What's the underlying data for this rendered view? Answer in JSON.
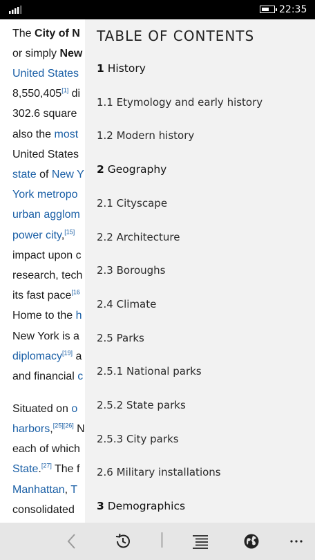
{
  "status_bar": {
    "time": "22:35",
    "battery_level": 0.6,
    "signal_bars": 4
  },
  "article": {
    "lines": [
      [
        {
          "t": "The "
        },
        {
          "t": "City of N",
          "b": true
        }
      ],
      [
        {
          "t": "or simply "
        },
        {
          "t": "New",
          "b": true
        }
      ],
      [
        {
          "t": "United States",
          "l": true
        }
      ],
      [
        {
          "t": "8,550,405"
        },
        {
          "t": "[1]",
          "s": true
        },
        {
          "t": " di"
        }
      ],
      [
        {
          "t": "302.6 square"
        }
      ],
      [
        {
          "t": "also the "
        },
        {
          "t": "most",
          "l": true
        }
      ],
      [
        {
          "t": "United States"
        }
      ],
      [
        {
          "t": "state",
          "l": true
        },
        {
          "t": " of "
        },
        {
          "t": "New Y",
          "l": true
        }
      ],
      [
        {
          "t": "York metropo",
          "l": true
        }
      ],
      [
        {
          "t": "urban agglom",
          "l": true
        }
      ],
      [
        {
          "t": "power city",
          "l": true
        },
        {
          "t": ","
        },
        {
          "t": "[15]",
          "s": true
        }
      ],
      [
        {
          "t": "impact upon c"
        }
      ],
      [
        {
          "t": "research, tech"
        }
      ],
      [
        {
          "t": "its fast pace"
        },
        {
          "t": "[16",
          "s": true
        }
      ],
      [
        {
          "t": "Home to the "
        },
        {
          "t": "h",
          "l": true
        }
      ],
      [
        {
          "t": "New York is a"
        }
      ],
      [
        {
          "t": "diplomacy",
          "l": true
        },
        {
          "t": "[19]",
          "s": true
        },
        {
          "t": " a"
        }
      ],
      [
        {
          "t": "and financial "
        },
        {
          "t": "c",
          "l": true
        }
      ],
      [
        {
          "t": "Situated on "
        },
        {
          "t": "o",
          "l": true
        }
      ],
      [
        {
          "t": "harbors",
          "l": true
        },
        {
          "t": ","
        },
        {
          "t": "[25][26]",
          "s": true
        },
        {
          "t": " N"
        }
      ],
      [
        {
          "t": "each of which"
        }
      ],
      [
        {
          "t": "State",
          "l": true
        },
        {
          "t": "."
        },
        {
          "t": "[27]",
          "s": true
        },
        {
          "t": " The f"
        }
      ],
      [
        {
          "t": "Manhattan",
          "l": true
        },
        {
          "t": ", "
        },
        {
          "t": "T",
          "l": true
        }
      ],
      [
        {
          "t": "consolidated"
        }
      ]
    ]
  },
  "toc": {
    "title": "TABLE OF CONTENTS",
    "items": [
      {
        "num": "1",
        "label": "History",
        "section": true
      },
      {
        "num": "1.1",
        "label": "Etymology and early history",
        "section": false
      },
      {
        "num": "1.2",
        "label": "Modern history",
        "section": false
      },
      {
        "num": "2",
        "label": "Geography",
        "section": true
      },
      {
        "num": "2.1",
        "label": "Cityscape",
        "section": false
      },
      {
        "num": "2.2",
        "label": "Architecture",
        "section": false
      },
      {
        "num": "2.3",
        "label": "Boroughs",
        "section": false
      },
      {
        "num": "2.4",
        "label": "Climate",
        "section": false
      },
      {
        "num": "2.5",
        "label": "Parks",
        "section": false
      },
      {
        "num": "2.5.1",
        "label": "National parks",
        "section": false
      },
      {
        "num": "2.5.2",
        "label": "State parks",
        "section": false
      },
      {
        "num": "2.5.3",
        "label": "City parks",
        "section": false
      },
      {
        "num": "2.6",
        "label": "Military installations",
        "section": false
      },
      {
        "num": "3",
        "label": "Demographics",
        "section": true
      }
    ]
  },
  "app_bar": {
    "buttons": [
      {
        "name": "back-button",
        "icon": "chevron-left-icon",
        "enabled": false
      },
      {
        "name": "history-button",
        "icon": "history-icon",
        "enabled": true
      },
      {
        "name": "contents-button",
        "icon": "list-icon",
        "enabled": true
      },
      {
        "name": "language-button",
        "icon": "globe-icon",
        "enabled": true
      },
      {
        "name": "more-button",
        "icon": "ellipsis-icon",
        "enabled": true
      }
    ]
  },
  "colors": {
    "link": "#1a5fa6",
    "panel_bg": "#f2f2f2",
    "app_bar_bg": "#e6e6e6",
    "status_bg": "#000000"
  }
}
